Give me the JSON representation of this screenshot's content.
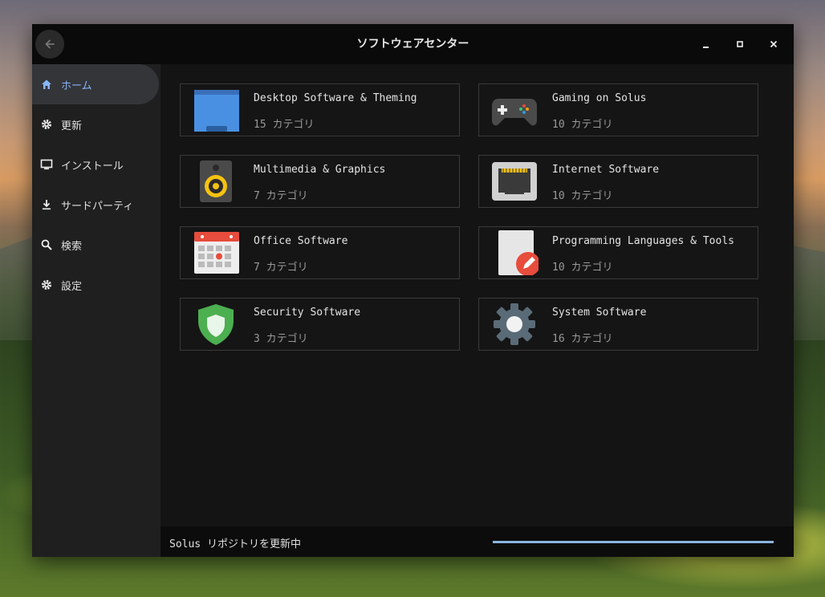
{
  "window": {
    "title": "ソフトウェアセンター"
  },
  "sidebar": {
    "items": [
      {
        "label": "ホーム",
        "icon": "home-icon",
        "active": true
      },
      {
        "label": "更新",
        "icon": "gear-icon"
      },
      {
        "label": "インストール",
        "icon": "monitor-icon"
      },
      {
        "label": "サードパーティ",
        "icon": "download-icon"
      },
      {
        "label": "検索",
        "icon": "search-icon"
      },
      {
        "label": "設定",
        "icon": "settings-icon"
      }
    ]
  },
  "categories": [
    {
      "name": "Desktop Software & Theming",
      "count": "15 カテゴリ",
      "icon": "folder-icon"
    },
    {
      "name": "Gaming on Solus",
      "count": "10 カテゴリ",
      "icon": "gamepad-icon"
    },
    {
      "name": "Multimedia & Graphics",
      "count": "7 カテゴリ",
      "icon": "speaker-icon"
    },
    {
      "name": "Internet Software",
      "count": "10 カテゴリ",
      "icon": "network-port-icon"
    },
    {
      "name": "Office Software",
      "count": "7 カテゴリ",
      "icon": "calendar-icon"
    },
    {
      "name": "Programming Languages & Tools",
      "count": "10 カテゴリ",
      "icon": "document-edit-icon"
    },
    {
      "name": "Security Software",
      "count": "3 カテゴリ",
      "icon": "shield-icon"
    },
    {
      "name": "System Software",
      "count": "16 カテゴリ",
      "icon": "system-gear-icon"
    }
  ],
  "status": {
    "text": "Solus リポジトリを更新中",
    "progress": 1.0
  },
  "colors": {
    "accent": "#8ab4f8",
    "progress": "#8ab4e0"
  }
}
